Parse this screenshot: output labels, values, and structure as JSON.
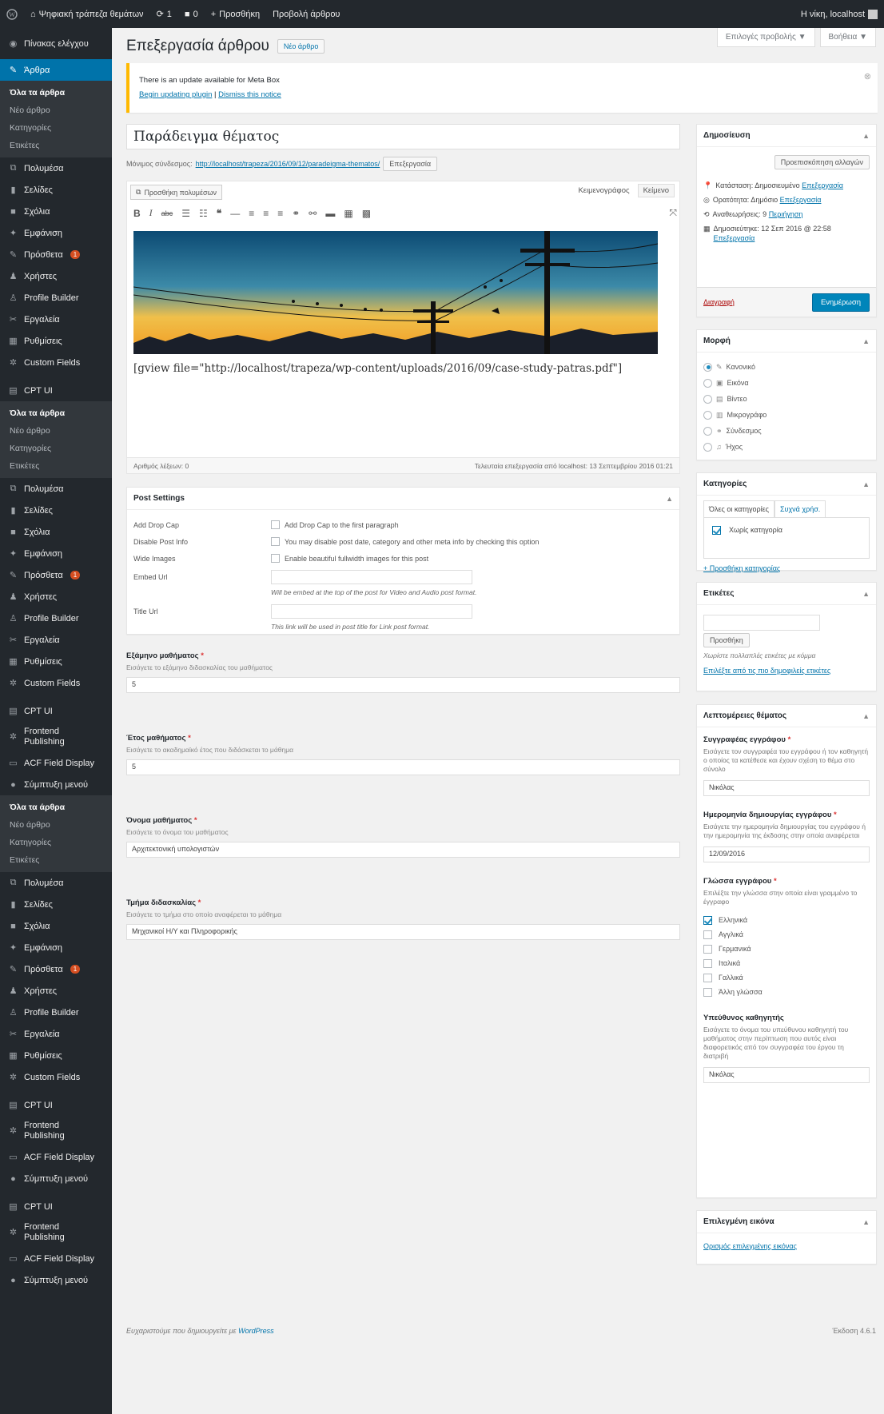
{
  "adminbar": {
    "site_name": "Ψηφιακή τράπεζα θεμάτων",
    "updates_count": "1",
    "comments_count": "0",
    "new_label": "Προσθήκη",
    "view_label": "Προβολή άρθρου",
    "howdy": "Η νίκη, localhost"
  },
  "sidebar": {
    "dashboard": "Πίνακας ελέγχου",
    "posts": "Άρθρα",
    "posts_sub": [
      "Όλα τα άρθρα",
      "Νέο άρθρο",
      "Κατηγορίες",
      "Ετικέτες"
    ],
    "group1": [
      {
        "label": "Πολυμέσα",
        "icon": "media-icon"
      },
      {
        "label": "Σελίδες",
        "icon": "pages-icon"
      },
      {
        "label": "Σχόλια",
        "icon": "comments-icon"
      },
      {
        "label": "Εμφάνιση",
        "icon": "appearance-icon"
      },
      {
        "label": "Πρόσθετα",
        "icon": "plugins-icon",
        "badge": "1"
      },
      {
        "label": "Χρήστες",
        "icon": "users-icon"
      },
      {
        "label": "Profile Builder",
        "icon": "profile-icon"
      },
      {
        "label": "Εργαλεία",
        "icon": "tools-icon"
      },
      {
        "label": "Ρυθμίσεις",
        "icon": "settings-icon"
      },
      {
        "label": "Custom Fields",
        "icon": "gear-icon"
      }
    ],
    "cpt_ui": "CPT UI",
    "sub2": [
      "Όλα τα άρθρα",
      "Νέο άρθρο",
      "Κατηγορίες",
      "Ετικέτες"
    ],
    "group2": [
      {
        "label": "Πολυμέσα",
        "icon": "media-icon"
      },
      {
        "label": "Σελίδες",
        "icon": "pages-icon"
      },
      {
        "label": "Σχόλια",
        "icon": "comments-icon"
      },
      {
        "label": "Εμφάνιση",
        "icon": "appearance-icon"
      },
      {
        "label": "Πρόσθετα",
        "icon": "plugins-icon",
        "badge": "1"
      },
      {
        "label": "Χρήστες",
        "icon": "users-icon"
      },
      {
        "label": "Profile Builder",
        "icon": "profile-icon"
      },
      {
        "label": "Εργαλεία",
        "icon": "tools-icon"
      },
      {
        "label": "Ρυθμίσεις",
        "icon": "settings-icon"
      },
      {
        "label": "Custom Fields",
        "icon": "gear-icon"
      }
    ],
    "cpt_ui_2": "CPT UI",
    "frontend": "Frontend Publishing",
    "acf": "ACF Field Display",
    "collapse": "Σύμπτυξη μενού",
    "sub3": [
      "Όλα τα άρθρα",
      "Νέο άρθρο",
      "Κατηγορίες",
      "Ετικέτες"
    ],
    "group3": [
      {
        "label": "Πολυμέσα",
        "icon": "media-icon"
      },
      {
        "label": "Σελίδες",
        "icon": "pages-icon"
      },
      {
        "label": "Σχόλια",
        "icon": "comments-icon"
      },
      {
        "label": "Εμφάνιση",
        "icon": "appearance-icon"
      },
      {
        "label": "Πρόσθετα",
        "icon": "plugins-icon",
        "badge": "1"
      },
      {
        "label": "Χρήστες",
        "icon": "users-icon"
      },
      {
        "label": "Profile Builder",
        "icon": "profile-icon"
      },
      {
        "label": "Εργαλεία",
        "icon": "tools-icon"
      },
      {
        "label": "Ρυθμίσεις",
        "icon": "settings-icon"
      },
      {
        "label": "Custom Fields",
        "icon": "gear-icon"
      }
    ],
    "tail": [
      "CPT UI",
      "Frontend Publishing",
      "ACF Field Display",
      "Σύμπτυξη μενού",
      "CPT UI",
      "Frontend Publishing",
      "ACF Field Display",
      "Σύμπτυξη μενού"
    ]
  },
  "header": {
    "screen_options": "Επιλογές προβολής ▼",
    "help": "Βοήθεια ▼",
    "title": "Επεξεργασία άρθρου",
    "new_post": "Νέο άρθρο"
  },
  "notice": {
    "text": "There is an update available for Meta Box",
    "link1": "Begin updating plugin",
    "sep": " | ",
    "link2": "Dismiss this notice"
  },
  "post": {
    "title": "Παράδειγμα θέματος",
    "permalink_label": "Μόνιμος σύνδεσμος:",
    "permalink_url": "http://localhost/trapeza/2016/09/12/paradeigma-thematos/",
    "edit_btn": "Επεξεργασία",
    "add_media": "Προσθήκη πολυμέσων",
    "tab_visual": "Κειμενογράφος",
    "tab_text": "Κείμενο",
    "shortcode": "[gview file=\"http://localhost/trapeza/wp-content/uploads/2016/09/case-study-patras.pdf\"]",
    "word_count": "Αριθμός λέξεων: 0",
    "last_edit": "Τελευταία επεξεργασία από localhost: 13 Σεπτεμβρίου 2016 01:21"
  },
  "post_settings": {
    "title": "Post Settings",
    "rows": [
      {
        "label": "Add Drop Cap",
        "text": "Add Drop Cap to the first paragraph"
      },
      {
        "label": "Disable Post Info",
        "text": "You may disable post date, category and other meta info by checking this option"
      },
      {
        "label": "Wide Images",
        "text": "Enable beautiful fullwidth images for this post"
      }
    ],
    "embed_label": "Embed Url",
    "embed_desc": "Will be embed at the top of the post for Video and Audio post format.",
    "file_label": "Title Url",
    "file_desc": "This link will be used in post title for Link post format."
  },
  "acf": [
    {
      "label": "Εξάμηνο μαθήματος",
      "inst": "Εισάγετε το εξάμηνο διδασκαλίας του μαθήματος",
      "value": "5"
    },
    {
      "label": "Έτος μαθήματος",
      "inst": "Εισάγετε το ακαδημαϊκό έτος που διδάσκεται το μάθημα",
      "value": "5"
    },
    {
      "label": "Όνομα μαθήματος",
      "inst": "Εισάγετε το όνομα του μαθήματος",
      "value": "Αρχιτεκτονική υπολογιστών"
    },
    {
      "label": "Τμήμα διδασκαλίας",
      "inst": "Εισάγετε το τμήμα στο οποίο αναφέρεται το μάθημα",
      "value": "Μηχανικοί Η/Υ και Πληροφορικής"
    }
  ],
  "publish": {
    "title": "Δημοσίευση",
    "preview": "Προεπισκόπηση αλλαγών",
    "status_label": "Κατάσταση: Δημοσιευμένο",
    "status_edit": "Επεξεργασία",
    "visibility_label": "Ορατότητα: Δημόσιο",
    "visibility_edit": "Επεξεργασία",
    "revisions_label": "Αναθεωρήσεις: 9",
    "revisions_link": "Περιήγηση",
    "published_label": "Δημοσιεύτηκε: 12 Σεπ 2016 @ 22:58",
    "published_edit": "Επεξεργασία",
    "trash": "Διαγραφή",
    "update": "Ενημέρωση"
  },
  "format": {
    "title": "Μορφή",
    "options": [
      {
        "label": "Κανονικό",
        "icon": "pin-icon",
        "checked": true
      },
      {
        "label": "Εικόνα",
        "icon": "image-icon",
        "checked": false
      },
      {
        "label": "Βίντεο",
        "icon": "video-icon",
        "checked": false
      },
      {
        "label": "Μικρογράφο",
        "icon": "gallery-icon",
        "checked": false
      },
      {
        "label": "Σύνδεσμος",
        "icon": "link-icon",
        "checked": false
      },
      {
        "label": "Ήχος",
        "icon": "audio-icon",
        "checked": false
      }
    ]
  },
  "categories": {
    "title": "Κατηγορίες",
    "tab_all": "Όλες οι κατηγορίες",
    "tab_popular": "Συχνά χρήσ.",
    "item": "Χωρίς κατηγορία",
    "add_link": "+ Προσθήκη κατηγορίας"
  },
  "tags": {
    "title": "Ετικέτες",
    "add_btn": "Προσθήκη",
    "hint": "Χωρίστε πολλαπλές ετικέτες με κόμμα",
    "choose_link": "Επιλέξτε από τις πιο δημοφιλείς ετικέτες"
  },
  "details": {
    "title": "Λεπτομέρειες θέματος",
    "author_label": "Συγγραφέας εγγράφου",
    "author_inst": "Εισάγετε τον συγγραφέα του εγγράφου ή τον καθηγητή ο οποίος τα κατέθεσε και έχουν σχέση το θέμα στο σύνολο",
    "author_value": "Νικόλας",
    "date_label": "Ημερομηνία δημιουργίας εγγράφου",
    "date_inst": "Εισάγετε την ημερομηνία δημιουργίας του εγγράφου ή την ημερομηνία της έκδοσης στην οποία αναφέρεται",
    "date_value": "12/09/2016",
    "lang_label": "Γλώσσα εγγράφου",
    "lang_inst": "Επιλέξτε την γλώσσα στην οποία είναι γραμμένο το έγγραφο",
    "langs": [
      {
        "label": "Ελληνικά",
        "checked": true
      },
      {
        "label": "Αγγλικά",
        "checked": false
      },
      {
        "label": "Γερμανικά",
        "checked": false
      },
      {
        "label": "Ιταλικά",
        "checked": false
      },
      {
        "label": "Γαλλικά",
        "checked": false
      },
      {
        "label": "Άλλη γλώσσα",
        "checked": false
      }
    ],
    "resp_label": "Υπεύθυνος καθηγητής",
    "resp_inst": "Εισάγετε το όνομα του υπεύθυνου καθηγητή του μαθήματος στην περίπτωση που αυτός είναι διαφορετικός από τον συγγραφέα του έργου τη διατριβή",
    "resp_value": "Νικόλας"
  },
  "featured": {
    "title": "Επιλεγμένη εικόνα",
    "link": "Ορισμός επιλεγμένης εικόνας"
  },
  "footer": {
    "thanks": "Ευχαριστούμε που δημιουργείτε με",
    "wp": "WordPress",
    "version": "Έκδοση 4.6.1"
  },
  "colors": {
    "accent": "#0073aa",
    "primary": "#0085ba",
    "adminbar": "#23282d",
    "notice": "#ffb900"
  }
}
